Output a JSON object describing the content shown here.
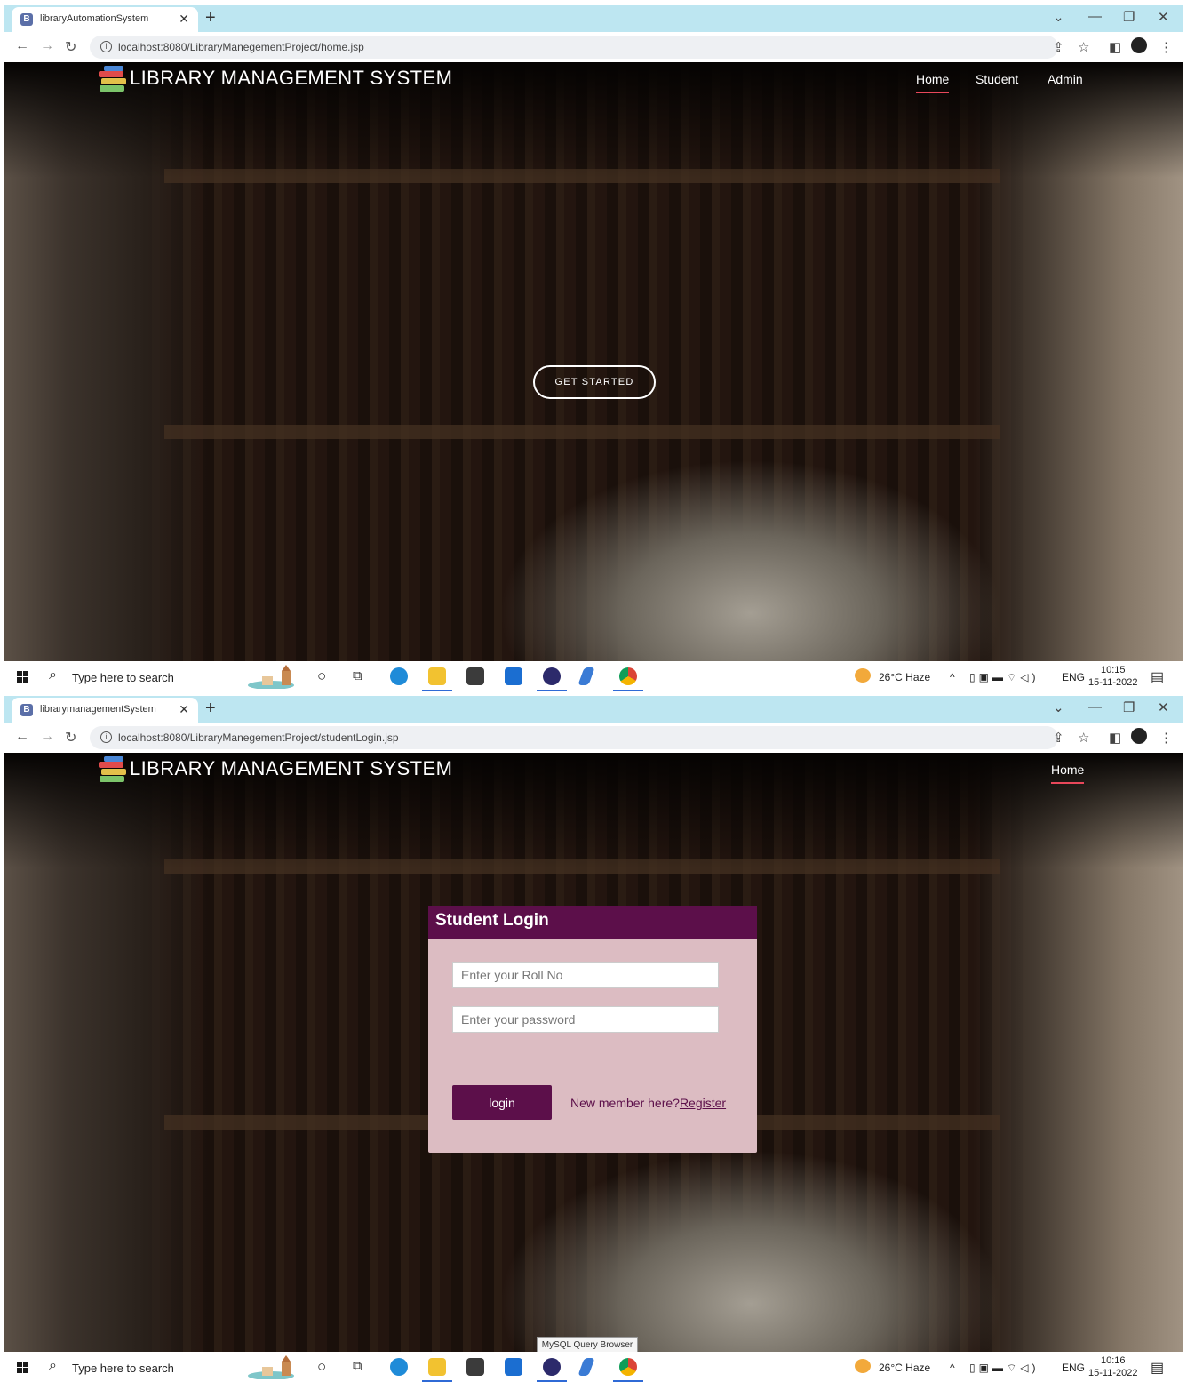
{
  "screen1": {
    "tab": {
      "favicon": "B",
      "title": "libraryAutomationSystem"
    },
    "url": "localhost:8080/LibraryManegementProject/home.jsp",
    "site": {
      "brand": "LIBRARY MANAGEMENT SYSTEM",
      "nav": [
        "Home",
        "Student",
        "Admin"
      ],
      "cta": "GET STARTED"
    },
    "taskbar": {
      "search": "Type here to search",
      "weather": "26°C  Haze",
      "lang": "ENG",
      "time": "10:15",
      "date": "15-11-2022"
    }
  },
  "screen2": {
    "tab": {
      "favicon": "B",
      "title": "librarymanagementSystem"
    },
    "url": "localhost:8080/LibraryManegementProject/studentLogin.jsp",
    "site": {
      "brand": "LIBRARY MANAGEMENT SYSTEM",
      "nav": [
        "Home"
      ]
    },
    "login": {
      "title": "Student Login",
      "roll_placeholder": "Enter your Roll No",
      "password_placeholder": "Enter your password",
      "button": "login",
      "register_prompt": "New member here?",
      "register_link": "Register"
    },
    "taskbar": {
      "search": "Type here to search",
      "weather": "26°C  Haze",
      "lang": "ENG",
      "time": "10:16",
      "date": "15-11-2022",
      "tooltip": "MySQL Query Browser"
    }
  },
  "colors": {
    "accent": "#5c0f4a",
    "card": "#dcbcc2",
    "nav_underline": "#e8475a",
    "tab_strip": "#bde6f1"
  },
  "icons": {
    "taskbar": [
      "windows-icon",
      "search-icon",
      "cortana-icon",
      "task-view-icon",
      "edge-icon",
      "file-explorer-icon",
      "mail-icon",
      "dell-icon",
      "eclipse-icon",
      "power-automate-icon",
      "chrome-icon"
    ],
    "tray": [
      "weather-icon",
      "chevron-up-icon",
      "battery-icon",
      "network-icon",
      "wifi-icon",
      "volume-icon",
      "notification-icon"
    ]
  }
}
